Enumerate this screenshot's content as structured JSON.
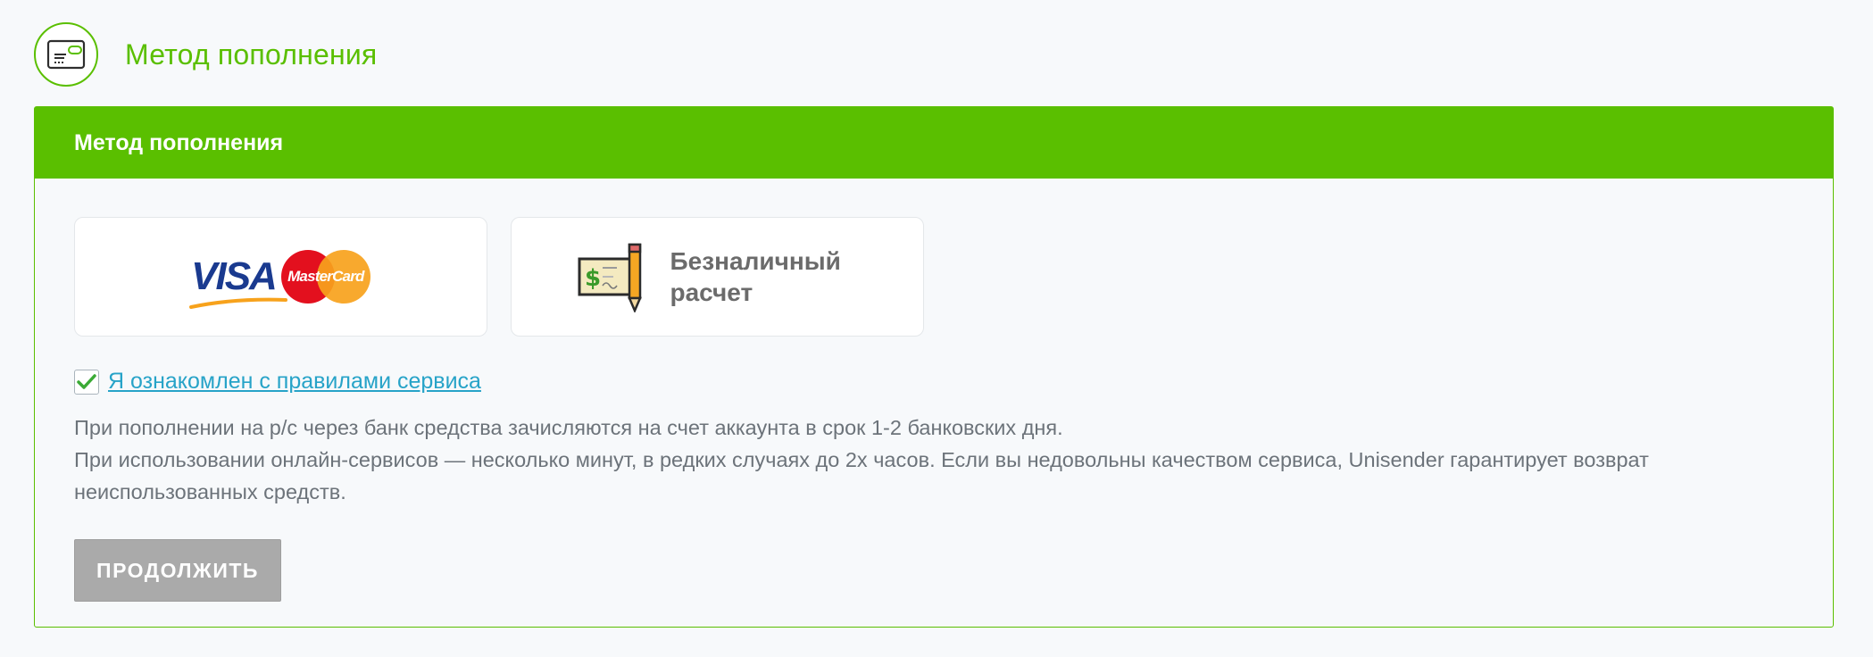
{
  "page": {
    "title": "Метод пополнения",
    "accent_color": "#5abf00"
  },
  "card": {
    "header_title": "Метод пополнения",
    "methods": [
      {
        "id": "card",
        "label_visa": "VISA",
        "label_mastercard": "MasterCard",
        "icon": "visa-mastercard-logo"
      },
      {
        "id": "cashless",
        "label": "Безналичный расчет",
        "icon": "cheque-pencil-icon"
      }
    ],
    "agree": {
      "checked": true,
      "label": "Я ознакомлен с правилами сервиса"
    },
    "note_line1": "При пополнении на р/с через банк средства зачисляются на счет аккаунта в срок 1-2 банковских дня.",
    "note_line2": "При использовании онлайн-сервисов — несколько минут, в редких случаях до 2х часов. Если вы недовольны качеством сервиса, Unisender гарантирует возврат неиспользованных средств.",
    "continue_label": "ПРОДОЛЖИТЬ"
  }
}
